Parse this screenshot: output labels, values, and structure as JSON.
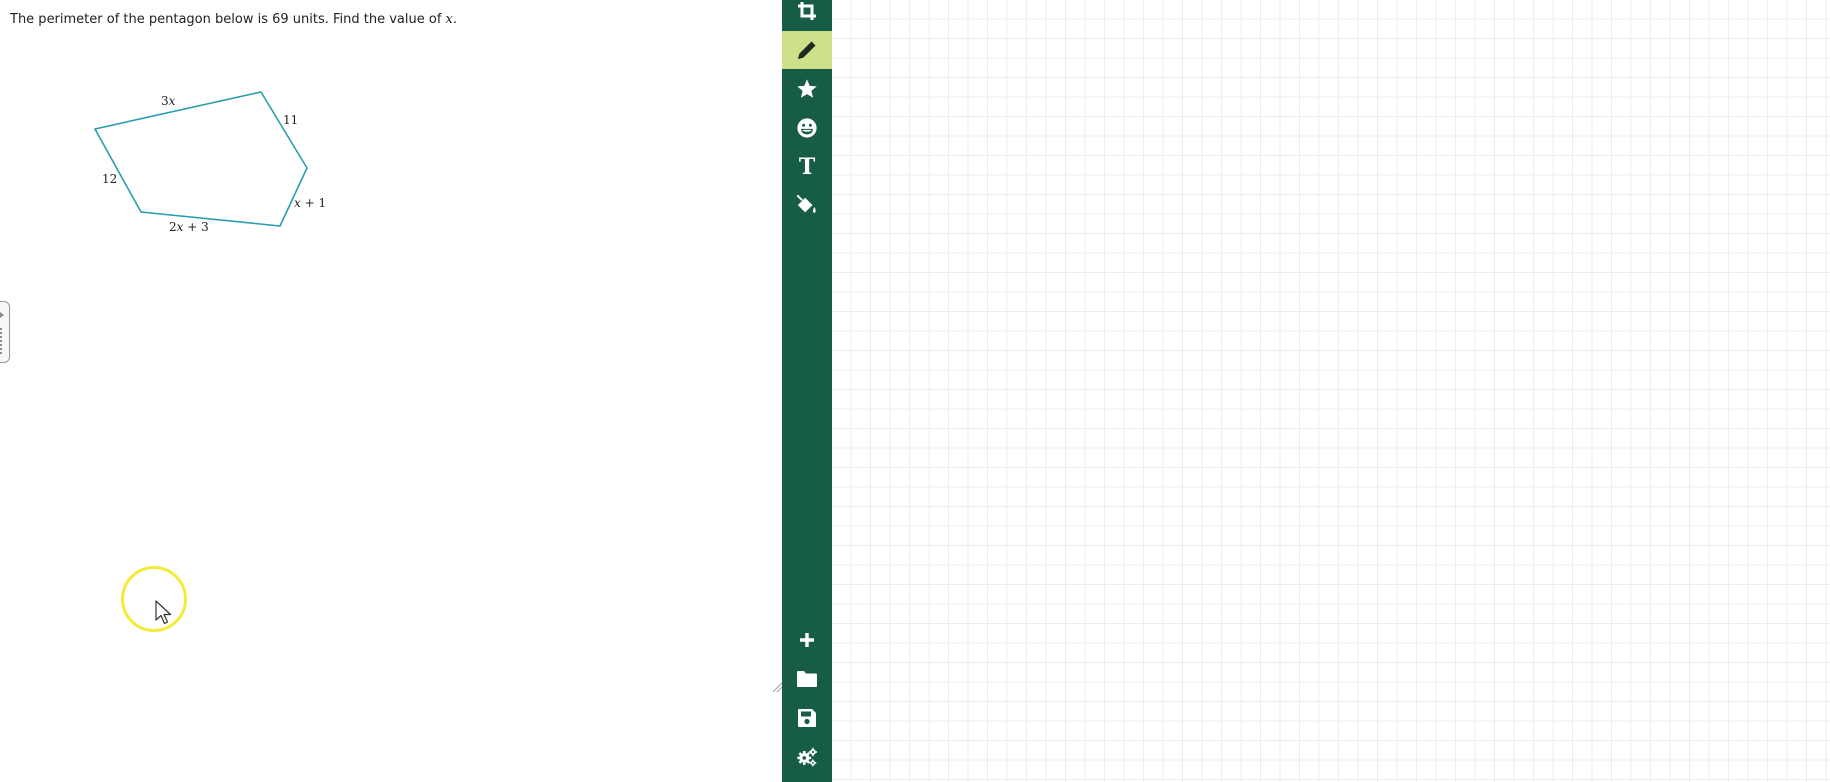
{
  "question": {
    "text_before": "The perimeter of the pentagon below is 69 units. Find the value of ",
    "variable": "x",
    "text_after": "."
  },
  "figure": {
    "stroke_color": "#2a9fb0",
    "labels": {
      "top_coef": "3",
      "top_var": "x",
      "upper_right": "11",
      "left": "12",
      "bottom_coef": "2",
      "bottom_var": "x",
      "bottom_rest": " + 3",
      "right_var": "x",
      "right_rest": " + 1"
    }
  },
  "toolbar": {
    "background": "#175c46",
    "active_color": "#cfe08a",
    "tools": [
      {
        "name": "crop",
        "icon": "crop-icon"
      },
      {
        "name": "pencil",
        "icon": "pencil-icon",
        "active": true
      },
      {
        "name": "star",
        "icon": "star-icon"
      },
      {
        "name": "emoji",
        "icon": "grin-icon"
      },
      {
        "name": "text",
        "icon": "text-icon",
        "glyph": "T"
      },
      {
        "name": "fill",
        "icon": "paint-bucket-icon"
      },
      {
        "name": "add",
        "icon": "plus-icon"
      },
      {
        "name": "open",
        "icon": "folder-icon"
      },
      {
        "name": "save",
        "icon": "save-icon"
      },
      {
        "name": "settings",
        "icon": "gears-icon"
      }
    ]
  },
  "cursor": {
    "highlight_color": "#f3ea3a"
  }
}
